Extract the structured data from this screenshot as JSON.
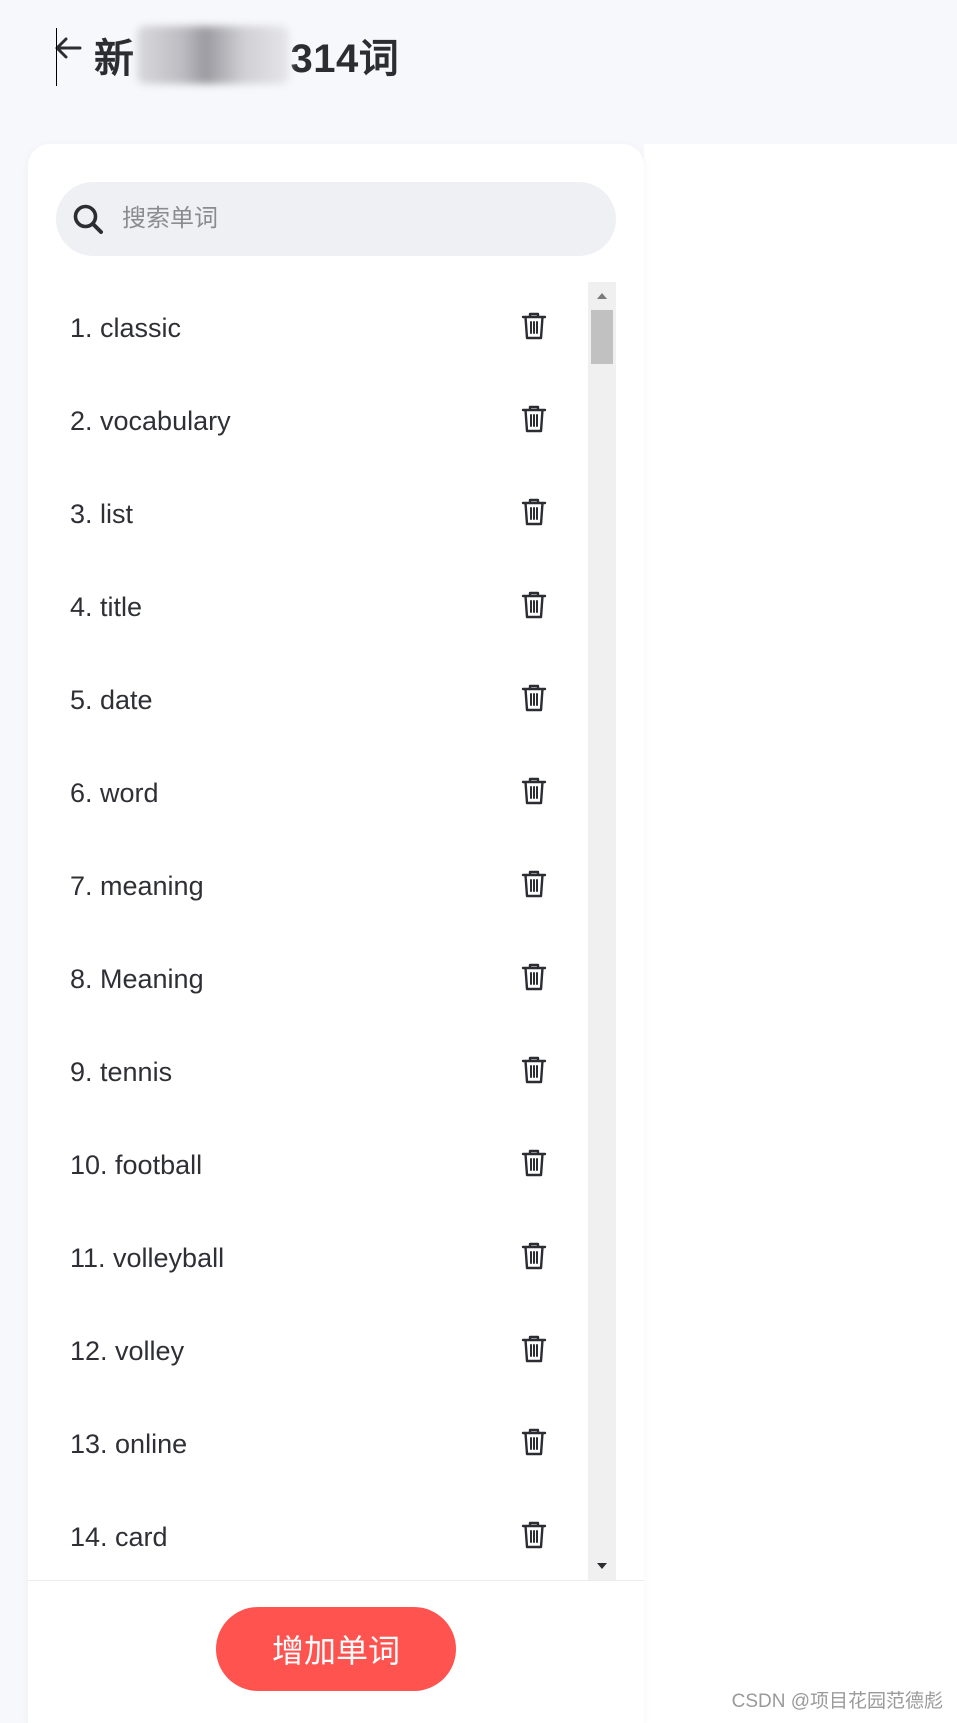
{
  "header": {
    "title_prefix": "新",
    "title_suffix": "314词"
  },
  "search": {
    "placeholder": "搜索单词",
    "value": ""
  },
  "words": [
    "1. classic",
    "2. vocabulary",
    "3. list",
    "4. title",
    "5. date",
    "6. word",
    "7. meaning",
    "8. Meaning",
    "9. tennis",
    "10. football",
    "11. volleyball",
    "12. volley",
    "13. online",
    "14. card"
  ],
  "footer": {
    "add_label": "增加单词"
  },
  "watermark": "CSDN @项目花园范德彪",
  "colors": {
    "accent": "#ff5350",
    "page_background": "#f7f8fc",
    "search_background": "#eff0f4"
  },
  "icons": {
    "back": "arrow-left-icon",
    "search": "search-icon",
    "delete": "trash-icon"
  }
}
